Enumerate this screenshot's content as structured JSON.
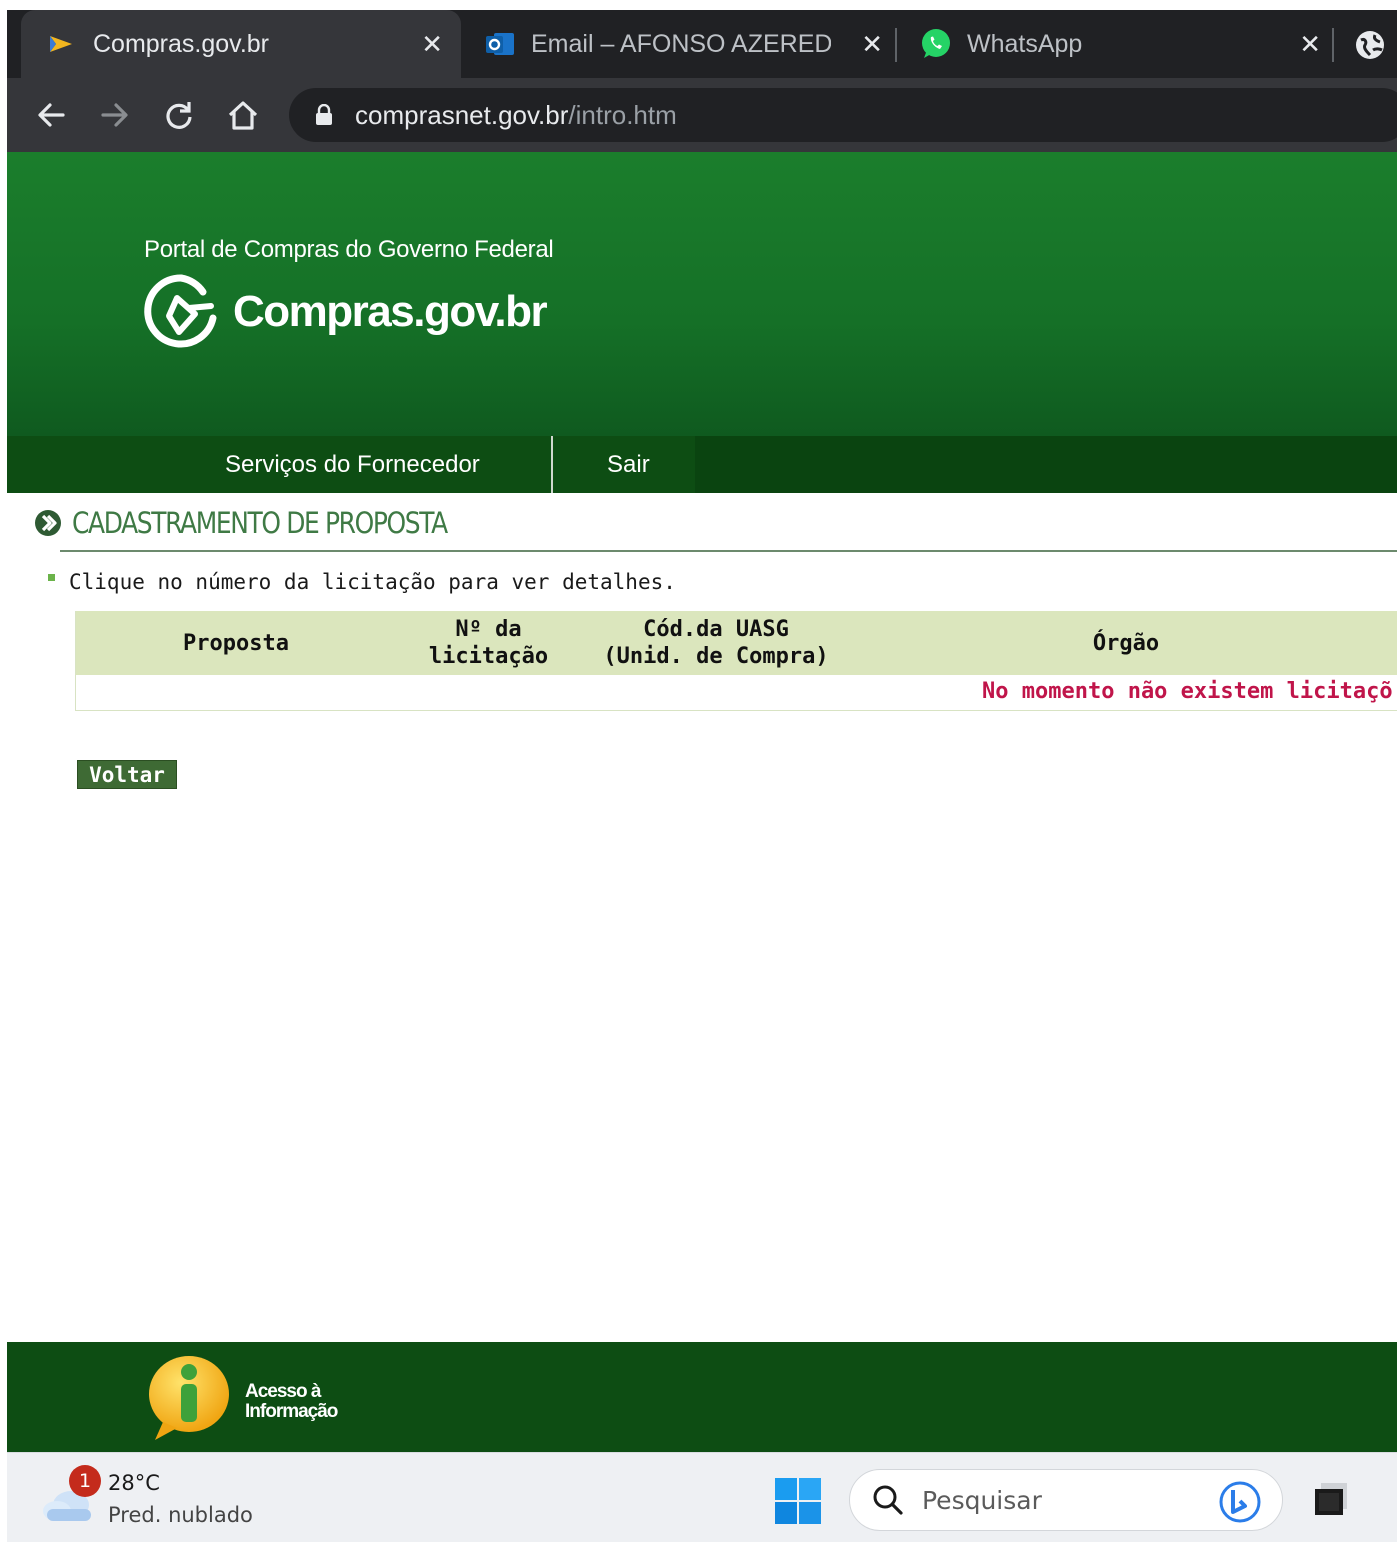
{
  "browser": {
    "tabs": [
      {
        "title": "Compras.gov.br",
        "favicon": "compras-gov-icon",
        "active": true
      },
      {
        "title": "Email – AFONSO AZEREDO –",
        "favicon": "outlook-icon",
        "active": false
      },
      {
        "title": "WhatsApp",
        "favicon": "whatsapp-icon",
        "active": false
      }
    ],
    "address": {
      "host": "comprasnet.gov.br",
      "path": "/intro.htm"
    }
  },
  "header": {
    "portal_label": "Portal de Compras do Governo Federal",
    "logo_text": "Compras.gov.br",
    "nav": [
      "Serviços do Fornecedor",
      "Sair"
    ]
  },
  "page": {
    "title": "CADASTRAMENTO DE PROPOSTA",
    "hint": "Clique no número da licitação para ver detalhes.",
    "table": {
      "columns": [
        "Proposta",
        "Nº da licitação",
        "Cód.da UASG (Unid. de Compra)",
        "Órgão"
      ],
      "columns_lines": [
        [
          "Proposta"
        ],
        [
          "Nº da",
          "licitação"
        ],
        [
          "Cód.da UASG",
          "(Unid. de Compra)"
        ],
        [
          "Órgão"
        ]
      ],
      "empty_message": "No momento não existem licitaçõ"
    },
    "back_button": "Voltar"
  },
  "footer": {
    "access_info_line1": "Acesso à",
    "access_info_line2": "Informação"
  },
  "taskbar": {
    "weather": {
      "temp": "28°C",
      "desc": "Pred. nublado",
      "badge": "1"
    },
    "search_placeholder": "Pesquisar"
  },
  "colors": {
    "header_green": "#1b7e2c",
    "nav_green": "#0d4d13",
    "table_header": "#dbe6bd",
    "alert_red": "#c0154a",
    "button_green": "#3e6a34"
  }
}
